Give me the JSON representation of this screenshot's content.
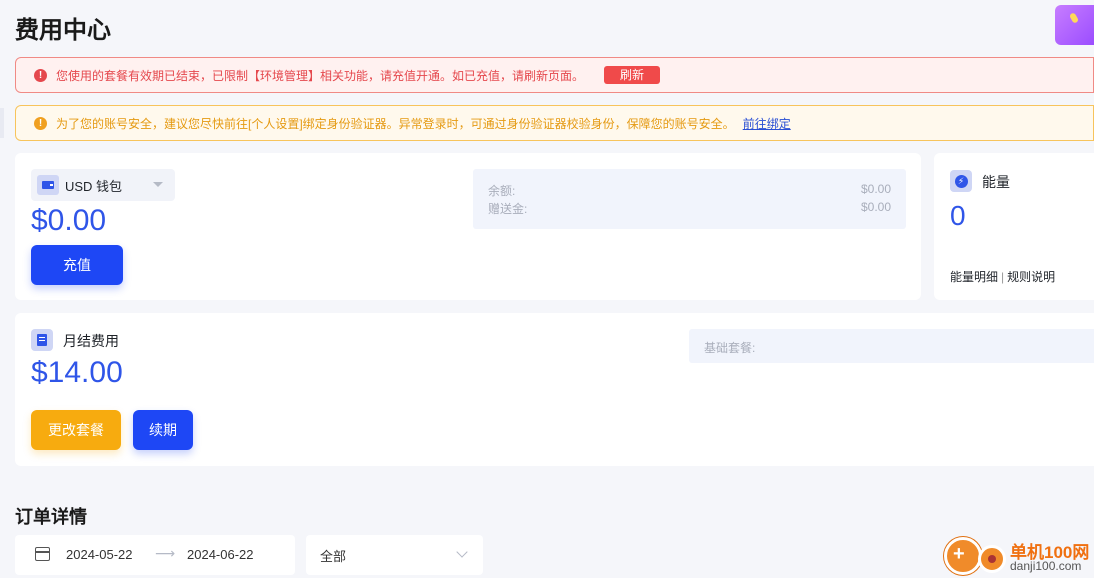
{
  "page": {
    "title": "费用中心"
  },
  "alerts": {
    "error": {
      "icon": "error-circle-icon",
      "text": "您使用的套餐有效期已结束，已限制【环境管理】相关功能，请充值开通。如已充值，请刷新页面。",
      "action_label": "刷新"
    },
    "warning": {
      "icon": "warning-circle-icon",
      "text": "为了您的账号安全，建议您尽快前往[个人设置]绑定身份验证器。异常登录时，可通过身份验证器校验身份，保障您的账号安全。",
      "link_label": "前往绑定"
    }
  },
  "wallet": {
    "icon": "wallet-icon",
    "selected": "USD 钱包",
    "amount": "$0.00",
    "recharge_label": "充值",
    "balance_label": "余额:",
    "balance_value": "$0.00",
    "bonus_label": "赠送金:",
    "bonus_value": "$0.00"
  },
  "energy": {
    "icon": "lightning-icon",
    "title": "能量",
    "value": "0",
    "detail_link": "能量明细",
    "rules_link": "规则说明"
  },
  "monthly": {
    "icon": "document-icon",
    "title": "月结费用",
    "amount": "$14.00",
    "change_label": "更改套餐",
    "renew_label": "续期",
    "plan_label": "基础套餐:"
  },
  "orders": {
    "title": "订单详情",
    "date_start": "2024-05-22",
    "date_end": "2024-06-22",
    "status_selected": "全部"
  },
  "watermark": {
    "brand": "单机100网",
    "domain": "danji100.com"
  },
  "colors": {
    "accent": "#2f55e8",
    "primary_button": "#1e47f5",
    "warning_button": "#f7ab0f",
    "error": "#e5484d",
    "warning": "#e59a12"
  }
}
